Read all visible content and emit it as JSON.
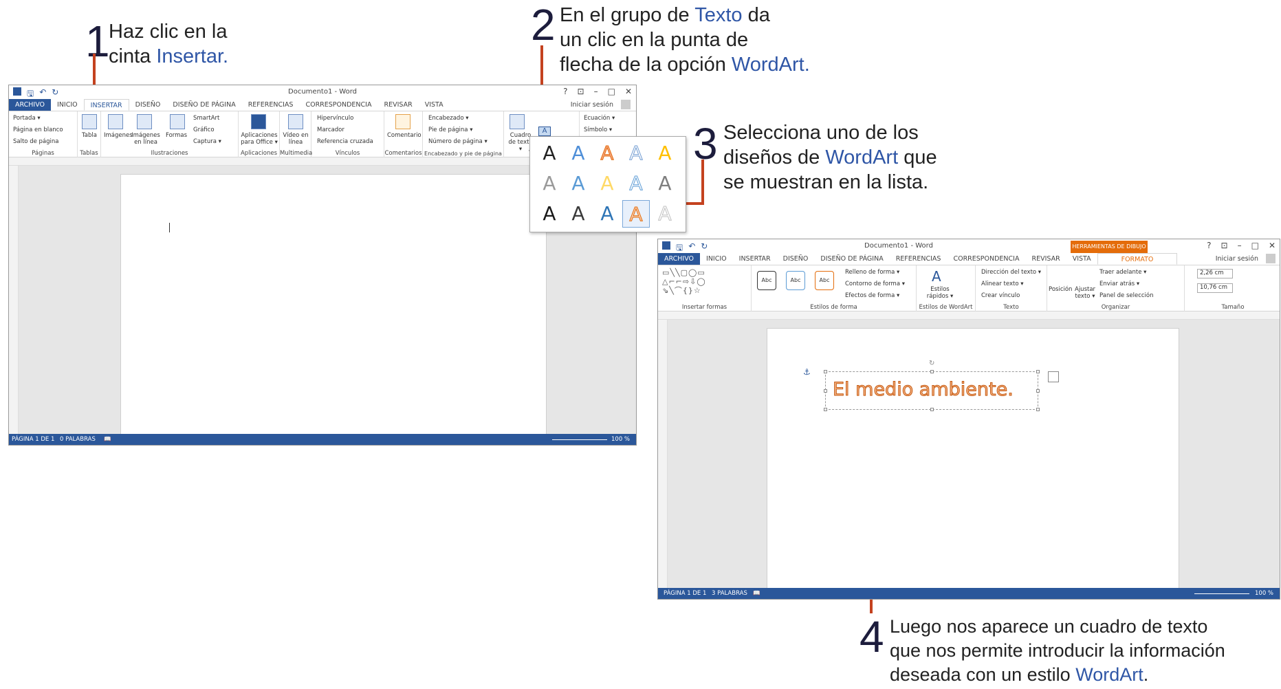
{
  "steps": [
    {
      "num": "1",
      "line1_a": "Haz clic en la",
      "line2_a": "cinta ",
      "line2_b": "Insertar."
    },
    {
      "num": "2",
      "line1_a": "En el grupo de ",
      "line1_b": "Texto",
      "line1_c": " da",
      "line2_a": "un clic en la punta de",
      "line3_a": "flecha de la opción ",
      "line3_b": "WordArt."
    },
    {
      "num": "3",
      "line1_a": "Selecciona uno de los",
      "line2_a": "diseños de ",
      "line2_b": "WordArt",
      "line2_c": " que",
      "line3_a": "se muestran en la lista."
    },
    {
      "num": "4",
      "line1_a": "Luego nos aparece un cuadro de texto",
      "line2_a": "que nos permite introducir la información",
      "line3_a": "deseada con un estilo ",
      "line3_b": "WordArt",
      "line3_c": "."
    }
  ],
  "colors": {
    "accent": "#2f56a6",
    "brand": "#2b579a",
    "callout_line": "#c4421f",
    "drawing_tools": "#e46c0a"
  },
  "win1": {
    "title": "Documento1 - Word",
    "qat_icons": [
      "word-icon",
      "save-icon",
      "undo-icon",
      "redo-icon"
    ],
    "window_controls": [
      "?",
      "⊡",
      "–",
      "□",
      "✕"
    ],
    "tabs": [
      "ARCHIVO",
      "INICIO",
      "INSERTAR",
      "DISEÑO",
      "DISEÑO DE PÁGINA",
      "REFERENCIAS",
      "CORRESPONDENCIA",
      "REVISAR",
      "VISTA"
    ],
    "signin": "Iniciar sesión",
    "groups": {
      "paginas": {
        "label": "Páginas",
        "items": [
          "Portada ▾",
          "Página en blanco",
          "Salto de página"
        ]
      },
      "tablas": {
        "label": "Tablas",
        "items": [
          "Tabla"
        ]
      },
      "ilustraciones": {
        "label": "Ilustraciones",
        "items": [
          "Imágenes",
          "Imágenes en línea",
          "Formas",
          "SmartArt",
          "Gráfico",
          "Captura ▾"
        ]
      },
      "aplicaciones": {
        "label": "Aplicaciones",
        "items": [
          "Aplicaciones para Office ▾"
        ]
      },
      "multimedia": {
        "label": "Multimedia",
        "items": [
          "Vídeo en línea"
        ]
      },
      "vinculos": {
        "label": "Vínculos",
        "items": [
          "Hipervínculo",
          "Marcador",
          "Referencia cruzada"
        ]
      },
      "comentarios": {
        "label": "Comentarios",
        "items": [
          "Comentario"
        ]
      },
      "encabezado": {
        "label": "Encabezado y pie de página",
        "items": [
          "Encabezado ▾",
          "Pie de página ▾",
          "Número de página ▾"
        ]
      },
      "texto": {
        "label": "Te",
        "items": [
          "Cuadro de texto ▾"
        ]
      },
      "simbolos": {
        "items": [
          "Ecuación ▾",
          "Símbolo ▾"
        ]
      }
    },
    "status": {
      "page": "PÁGINA 1 DE 1",
      "words": "0 PALABRAS",
      "zoom": "100 %"
    }
  },
  "gallery": {
    "styles": [
      {
        "color": "#222222",
        "stroke": "none"
      },
      {
        "color": "#4f8fd8",
        "stroke": "none"
      },
      {
        "color": "#f4a582",
        "stroke": "#e46c0a"
      },
      {
        "color": "#ffffff",
        "stroke": "#6f9bd1"
      },
      {
        "color": "#ffc000",
        "stroke": "none"
      },
      {
        "color": "#9a9a9a",
        "stroke": "none"
      },
      {
        "color": "#5b9bd5",
        "stroke": "none"
      },
      {
        "color": "#ffd966",
        "stroke": "none"
      },
      {
        "color": "#ffffff",
        "stroke": "#5b9bd5"
      },
      {
        "color": "#7f7f7f",
        "stroke": "none"
      },
      {
        "color": "#1a1a1a",
        "stroke": "none"
      },
      {
        "color": "#3a3a3a",
        "stroke": "none"
      },
      {
        "color": "#2e75b6",
        "stroke": "none"
      },
      {
        "color": "#f8cbad",
        "stroke": "#e46c0a"
      },
      {
        "color": "#ffffff",
        "stroke": "#bfbfbf"
      }
    ],
    "glyph": "A",
    "selected_index": 13
  },
  "win2": {
    "title": "Documento1 - Word",
    "contextual_header": "HERRAMIENTAS DE DIBUJO",
    "tabs": [
      "ARCHIVO",
      "INICIO",
      "INSERTAR",
      "DISEÑO",
      "DISEÑO DE PÁGINA",
      "REFERENCIAS",
      "CORRESPONDENCIA",
      "REVISAR",
      "VISTA",
      "FORMATO"
    ],
    "signin": "Iniciar sesión",
    "groups": {
      "insertar_formas": {
        "label": "Insertar formas"
      },
      "estilos_forma": {
        "label": "Estilos de forma",
        "samples": [
          "Abc",
          "Abc",
          "Abc"
        ],
        "items": [
          "Relleno de forma ▾",
          "Contorno de forma ▾",
          "Efectos de forma ▾"
        ]
      },
      "estilos_wordart": {
        "label": "Estilos de WordArt",
        "items": [
          "Estilos rápidos ▾"
        ]
      },
      "texto": {
        "label": "Texto",
        "items": [
          "Dirección del texto ▾",
          "Alinear texto ▾",
          "Crear vínculo"
        ]
      },
      "organizar": {
        "label": "Organizar",
        "items": [
          "Posición",
          "Ajustar texto ▾",
          "Traer adelante ▾",
          "Enviar atrás ▾",
          "Panel de selección"
        ]
      },
      "tamano": {
        "label": "Tamaño",
        "height": "2,26 cm",
        "width": "10,76 cm"
      }
    },
    "wordart_text": "El medio ambiente.",
    "status": {
      "page": "PÁGINA 1 DE 1",
      "words": "3 PALABRAS",
      "zoom": "100 %"
    }
  }
}
